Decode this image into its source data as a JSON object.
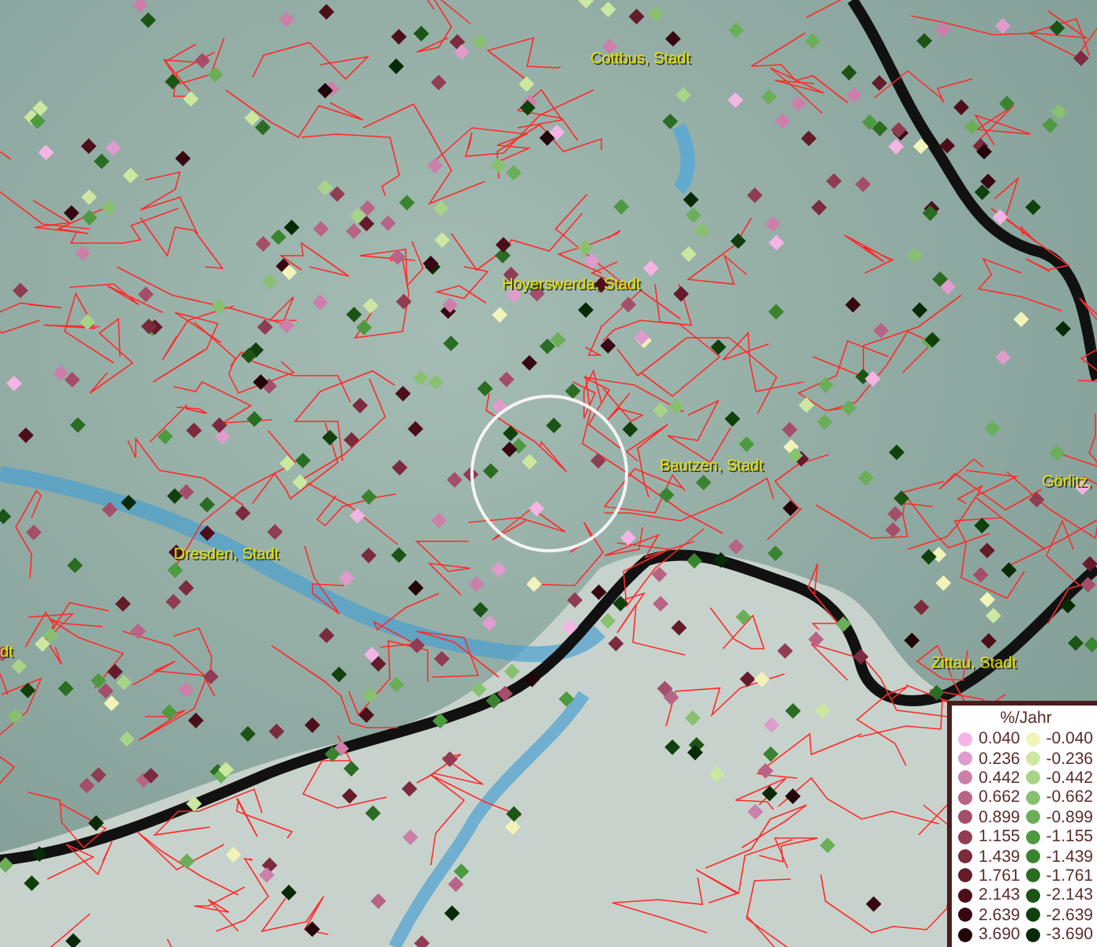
{
  "map": {
    "places": [
      {
        "label": "Cottbus, Stadt"
      },
      {
        "label": "Hoyerswerda, Stadt"
      },
      {
        "label": "Bautzen, Stadt"
      },
      {
        "label": "Görlitz,"
      },
      {
        "label": "Dresden, Stadt"
      },
      {
        "label": "dt"
      },
      {
        "label": "Zittau, Stadt"
      }
    ]
  },
  "legend": {
    "title": "%/Jahr",
    "positive": [
      {
        "label": "0.040",
        "color": "#f4b4e4"
      },
      {
        "label": "0.236",
        "color": "#e09ccc"
      },
      {
        "label": "0.442",
        "color": "#cc7fa8"
      },
      {
        "label": "0.662",
        "color": "#b86486"
      },
      {
        "label": "0.899",
        "color": "#a44e6a"
      },
      {
        "label": "1.155",
        "color": "#903c52"
      },
      {
        "label": "1.439",
        "color": "#7c2a3e"
      },
      {
        "label": "1.761",
        "color": "#641c2a"
      },
      {
        "label": "2.143",
        "color": "#4c0f1a"
      },
      {
        "label": "2.639",
        "color": "#380812"
      },
      {
        "label": "3.690",
        "color": "#22040a"
      }
    ],
    "negative": [
      {
        "label": "-0.040",
        "color": "#f0f4b8"
      },
      {
        "label": "-0.236",
        "color": "#cce8a0"
      },
      {
        "label": "-0.442",
        "color": "#a8d488"
      },
      {
        "label": "-0.662",
        "color": "#88c070"
      },
      {
        "label": "-0.899",
        "color": "#6aae58"
      },
      {
        "label": "-1.155",
        "color": "#4e9a40"
      },
      {
        "label": "-1.439",
        "color": "#3a8430"
      },
      {
        "label": "-1.761",
        "color": "#2a6c22"
      },
      {
        "label": "-2.143",
        "color": "#1c5416"
      },
      {
        "label": "-2.639",
        "color": "#10400c"
      },
      {
        "label": "-3.690",
        "color": "#082a06"
      }
    ]
  }
}
